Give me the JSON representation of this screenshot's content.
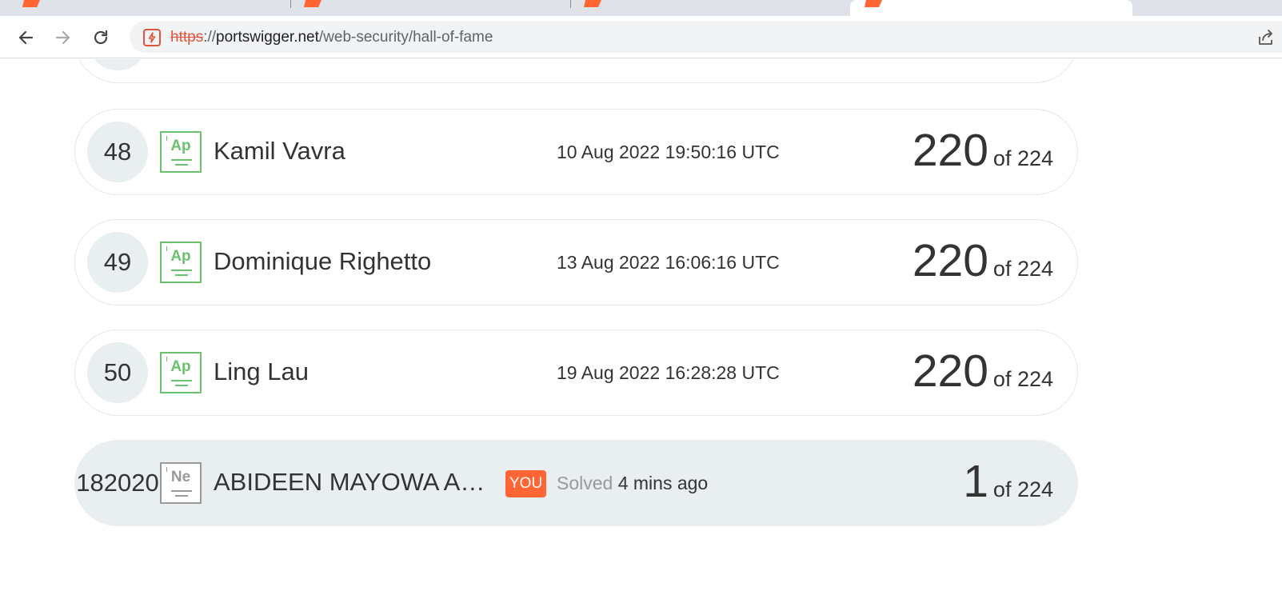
{
  "browser": {
    "url_scheme": "https",
    "url_separator": "://",
    "url_host": "portswigger.net",
    "url_path": "/web-security/hall-of-fame",
    "accent": "#ff6633"
  },
  "leaderboard": {
    "rows": [
      {
        "rank": "48",
        "badge_symbol": "Ap",
        "name": "Kamil Vavra",
        "date": "10 Aug 2022 19:50:16 UTC",
        "score": "220",
        "of_total": "of 224"
      },
      {
        "rank": "49",
        "badge_symbol": "Ap",
        "name": "Dominique Righetto",
        "date": "13 Aug 2022 16:06:16 UTC",
        "score": "220",
        "of_total": "of 224"
      },
      {
        "rank": "50",
        "badge_symbol": "Ap",
        "name": "Ling Lau",
        "date": "19 Aug 2022 16:28:28 UTC",
        "score": "220",
        "of_total": "of 224"
      }
    ],
    "current_user": {
      "rank": "182020",
      "badge_symbol": "Ne",
      "name": "ABIDEEN MAYOWA A…",
      "you_label": "YOU",
      "solved_label": "Solved",
      "solved_ago": "4 mins ago",
      "score": "1",
      "of_total": "of 224"
    }
  }
}
